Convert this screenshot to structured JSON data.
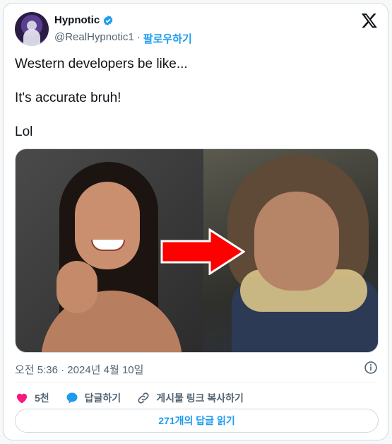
{
  "author": {
    "name": "Hypnotic",
    "handle": "@RealHypnotic1",
    "separator": "·",
    "follow_label": "팔로우하기"
  },
  "post": {
    "lines": [
      "Western developers be like...",
      "It's accurate bruh!",
      "Lol"
    ],
    "timestamp": "오전 5:36 · 2024년 4월 10일"
  },
  "actions": {
    "like_count": "5천",
    "reply_label": "답글하기",
    "copy_link_label": "게시물 링크 복사하기"
  },
  "replies_button": "271개의 답글 읽기",
  "icons": {
    "verified": "verified-badge-icon",
    "x_logo": "x-logo-icon",
    "info": "info-icon",
    "heart": "heart-icon",
    "reply": "reply-bubble-icon",
    "link": "link-icon",
    "arrow": "red-arrow-icon"
  },
  "colors": {
    "accent": "#1d9bf0",
    "like": "#f91880",
    "arrow": "#ff0000",
    "text": "#0f1419",
    "muted": "#536471"
  }
}
